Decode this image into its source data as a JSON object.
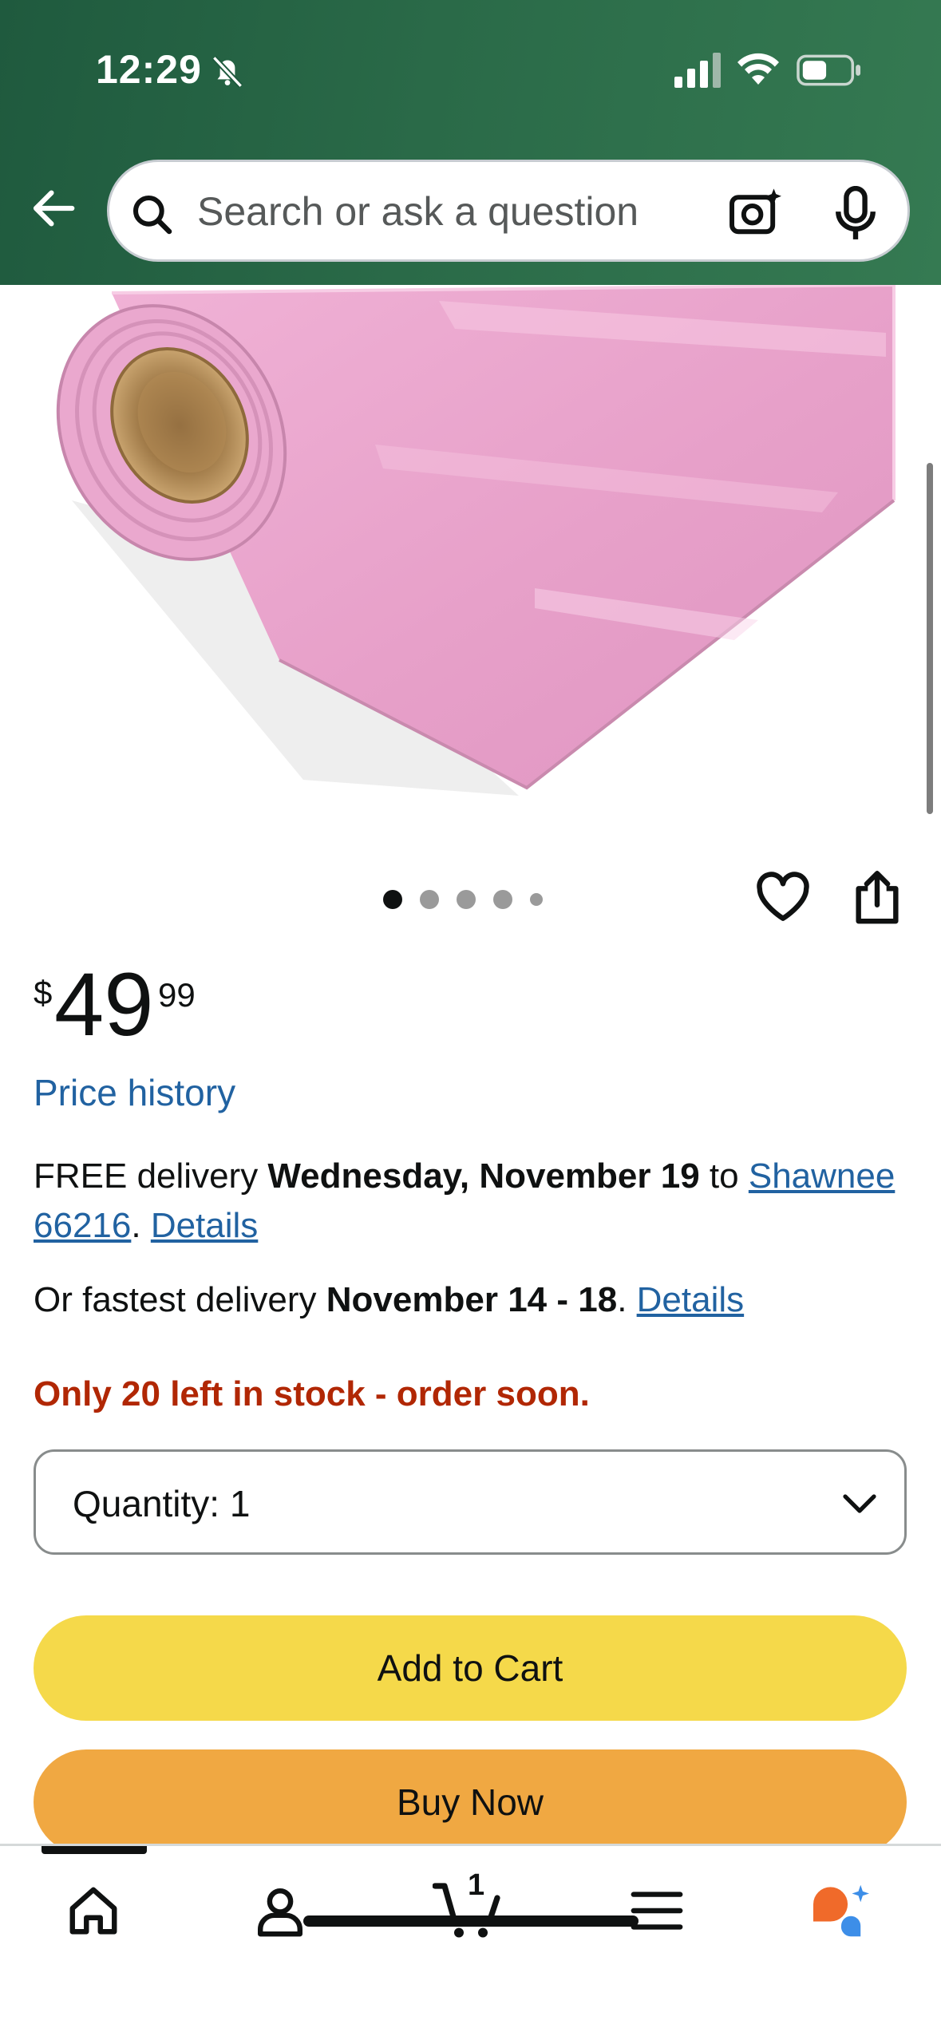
{
  "status_bar": {
    "time": "12:29"
  },
  "search": {
    "placeholder": "Search or ask a question"
  },
  "product": {
    "carousel": {
      "count": 5,
      "active_index": 0
    },
    "price": {
      "symbol": "$",
      "whole": "49",
      "fraction": "99"
    },
    "price_history_label": "Price history",
    "delivery": {
      "prefix": "FREE delivery ",
      "date": "Wednesday, November 19",
      "to_text": " to ",
      "location": "Shawnee 66216",
      "sep": ". ",
      "details_label": "Details"
    },
    "fastest": {
      "prefix": "Or fastest delivery ",
      "date": "November 14 - 18",
      "sep": ". ",
      "details_label": "Details"
    },
    "stock_text": "Only 20 left in stock - order soon.",
    "quantity_label": "Quantity:",
    "quantity_value": "1",
    "add_to_cart_label": "Add to Cart",
    "buy_now_label": "Buy Now"
  },
  "bottom_nav": {
    "cart_count": "1",
    "items": [
      "home-icon",
      "account-icon",
      "cart-icon",
      "menu-icon",
      "rufus-icon"
    ]
  },
  "colors": {
    "header": "#2a6a48",
    "link": "#2162a1",
    "stock": "#b12704",
    "add_to_cart": "#f5d94a",
    "buy_now": "#f0a842",
    "product_pink": "#e9a3cc"
  }
}
